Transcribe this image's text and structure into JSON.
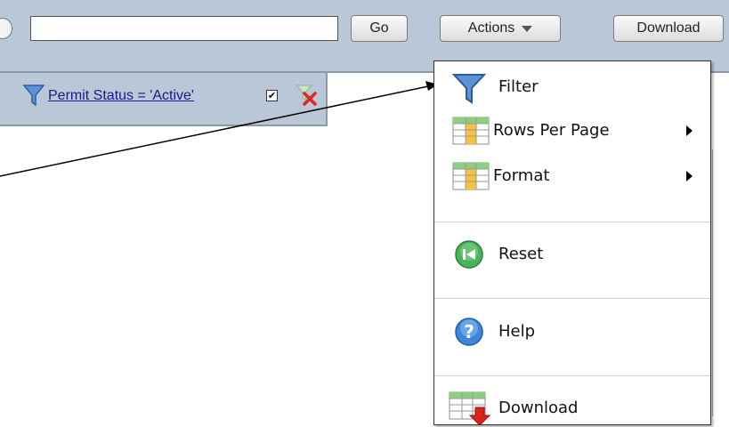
{
  "toolbar": {
    "search_value": "",
    "go_label": "Go",
    "actions_label": "Actions",
    "download_label": "Download"
  },
  "filter": {
    "text": "Permit Status = 'Active'",
    "enabled": true
  },
  "menu": {
    "filter": "Filter",
    "rows_per_page": "Rows Per Page",
    "format": "Format",
    "reset": "Reset",
    "help": "Help",
    "download": "Download"
  }
}
